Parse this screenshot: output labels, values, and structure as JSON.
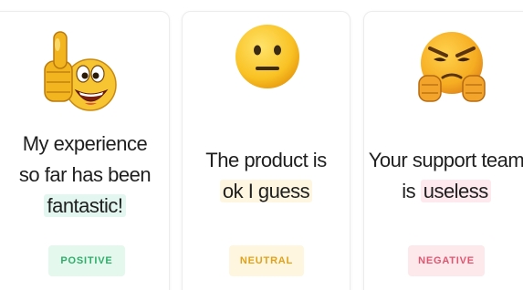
{
  "cards": [
    {
      "lines": [
        "My experience",
        "so far has been"
      ],
      "highlight": "fantastic!",
      "sentiment": "POSITIVE",
      "emoji": "thumbs-up-grin-icon",
      "accent": "#2fae6a"
    },
    {
      "lines": [
        "The product is"
      ],
      "highlight": "ok I guess",
      "sentiment": "NEUTRAL",
      "emoji": "neutral-face-icon",
      "accent": "#e0a21b"
    },
    {
      "lines": [
        "Your support team"
      ],
      "prefix": "is ",
      "highlight": "useless",
      "sentiment": "NEGATIVE",
      "emoji": "angry-thumbs-down-icon",
      "accent": "#e0566f"
    }
  ]
}
